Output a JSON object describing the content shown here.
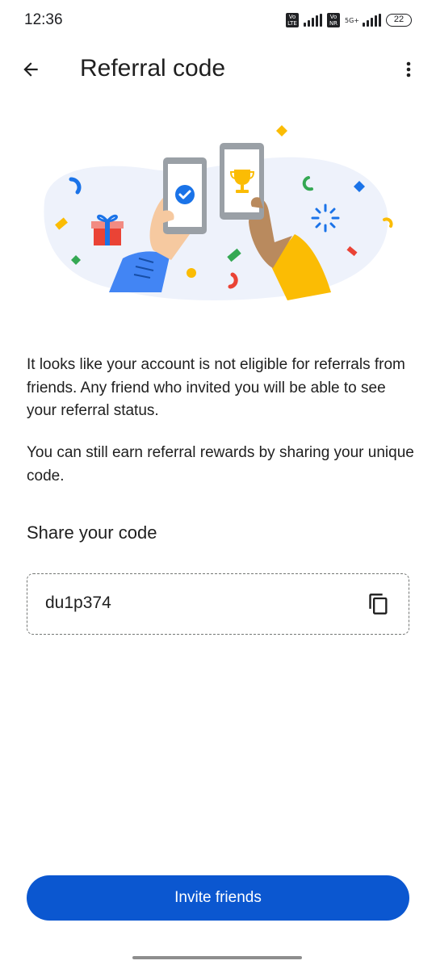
{
  "status_bar": {
    "time": "12:36",
    "volte_1": "Vo LTE",
    "volte_2": "Vo NR",
    "network": "5G+",
    "battery": "22"
  },
  "app_bar": {
    "title": "Referral code",
    "back_icon": "arrow-back-icon",
    "menu_icon": "more-vert-icon"
  },
  "illustration": {
    "name": "referral-hands-phones-illustration"
  },
  "content": {
    "paragraph_1": "It looks like your account is not eligible for referrals from friends. Any friend who invited you will be able to see your referral status.",
    "paragraph_2": "You can still earn referral rewards by sharing your unique code.",
    "share_title": "Share your code",
    "code": "du1p374",
    "copy_icon": "copy-icon"
  },
  "actions": {
    "invite_label": "Invite friends"
  },
  "colors": {
    "primary": "#0b57d0",
    "text": "#1f1f1f",
    "blob": "#eef2fb"
  }
}
